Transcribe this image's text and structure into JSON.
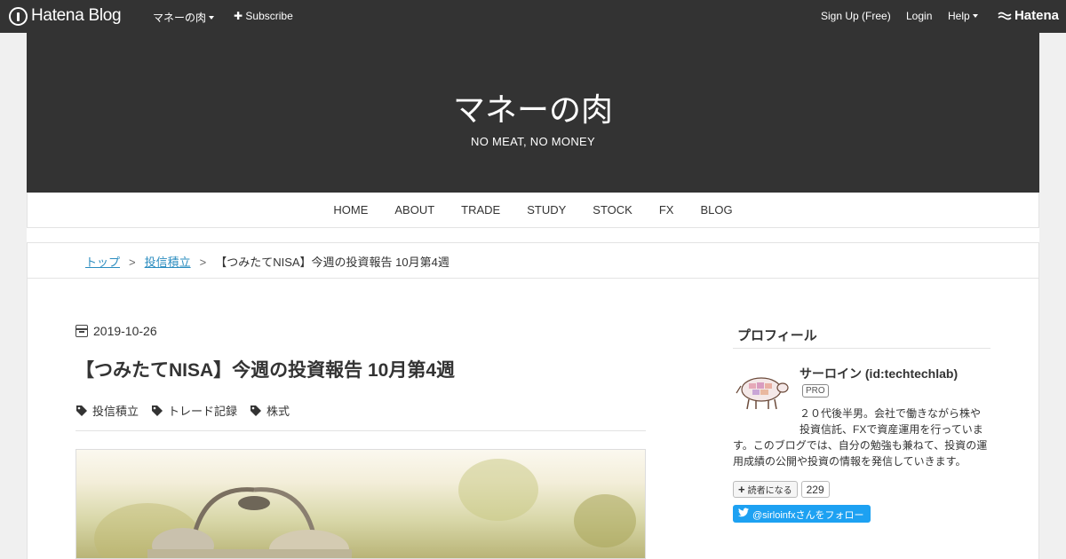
{
  "globalbar": {
    "logo": "Hatena Blog",
    "blog_menu": "マネーの肉",
    "subscribe": "Subscribe",
    "signup": "Sign Up (Free)",
    "login": "Login",
    "help": "Help",
    "hatena": "Hatena",
    "bg_color": "#333333"
  },
  "header": {
    "title": "マネーの肉",
    "description": "NO MEAT, NO MONEY"
  },
  "nav": {
    "items": [
      "HOME",
      "ABOUT",
      "TRADE",
      "STUDY",
      "STOCK",
      "FX",
      "BLOG"
    ]
  },
  "breadcrumb": {
    "top": "トップ",
    "category": "投信積立",
    "current": "【つみたてNISA】今週の投資報告 10月第4週",
    "sep": ">"
  },
  "article": {
    "date": "2019-10-26",
    "title": "【つみたてNISA】今週の投資報告 10月第4週",
    "categories": [
      "投信積立",
      "トレード記録",
      "株式"
    ]
  },
  "sidebar": {
    "title": "プロフィール",
    "name": "サーロイン (id:techtechlab)",
    "badge": "PRO",
    "bio_line1": "２０代後半男。会社で働きながら株や投資信託、FXで資産運用を行っていま",
    "bio_rest": "す。このブログでは、自分の勉強も兼ねて、投資の運用成績の公開や投資の情報を発信していきます。",
    "reader_label": "読者になる",
    "reader_count": "229",
    "twitter_label": "@sirloinfxさんをフォロー",
    "twitter_color": "#1da1f2",
    "link_color": "#2a8cbf"
  }
}
